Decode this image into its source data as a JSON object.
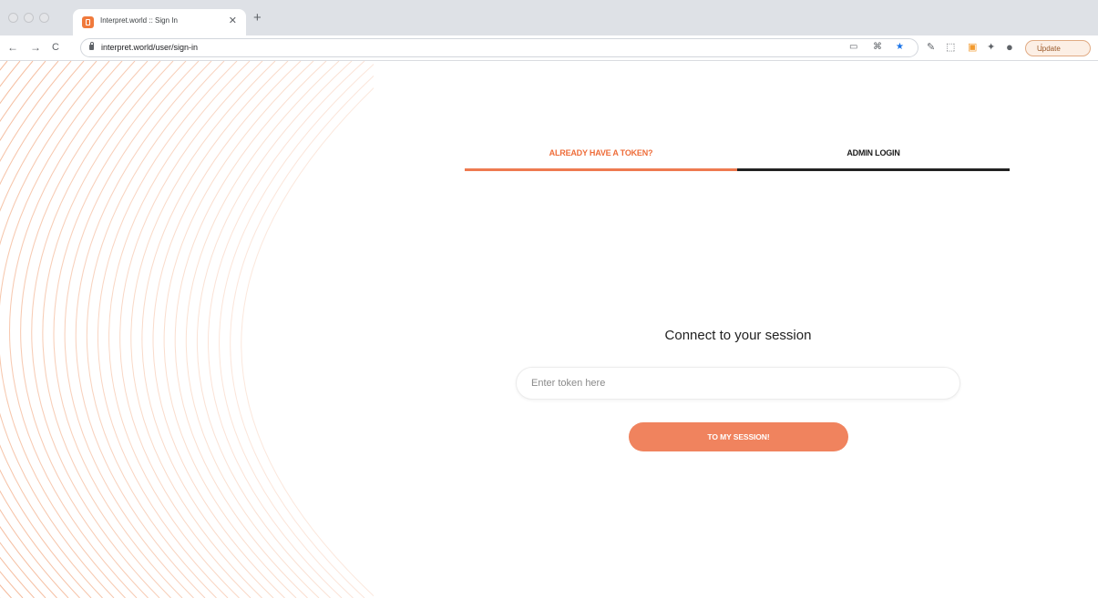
{
  "browser": {
    "tab": {
      "title": "Interpret.world :: Sign In",
      "close_icon": "close-icon",
      "favicon": "interpret-favicon"
    },
    "new_tab_icon": "plus-icon",
    "nav": {
      "back": "←",
      "forward": "→",
      "reload": "C"
    },
    "url": "interpret.world/user/sign-in",
    "update_label": "Update"
  },
  "login": {
    "tabs": [
      {
        "label": "ALREADY HAVE A TOKEN?",
        "active": true
      },
      {
        "label": "ADMIN LOGIN",
        "active": false
      }
    ],
    "heading": "Connect to your session",
    "token_placeholder": "Enter token here",
    "token_value": "",
    "submit_label": "TO MY SESSION!"
  },
  "colors": {
    "accent": "#ee6d3a",
    "button": "#f0835e",
    "line_art": "#f3b08c"
  }
}
